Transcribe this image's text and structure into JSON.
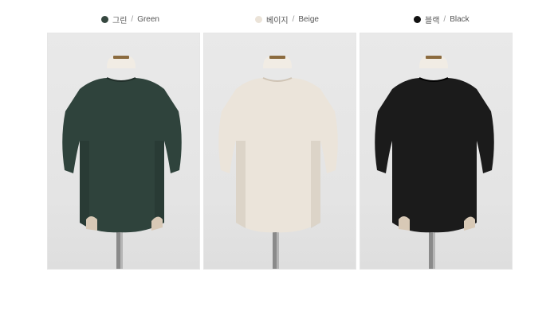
{
  "colors": [
    {
      "ko": "그린",
      "sep": "/",
      "en": "Green",
      "swatch": "#35473f",
      "fabric": "#2f433c",
      "shadow": "#1f2d28"
    },
    {
      "ko": "베이지",
      "sep": "/",
      "en": "Beige",
      "swatch": "#ebe3d8",
      "fabric": "#ebe4da",
      "shadow": "#d2c9bd"
    },
    {
      "ko": "블랙",
      "sep": "/",
      "en": "Black",
      "swatch": "#111111",
      "fabric": "#1b1b1b",
      "shadow": "#0a0a0a"
    }
  ]
}
